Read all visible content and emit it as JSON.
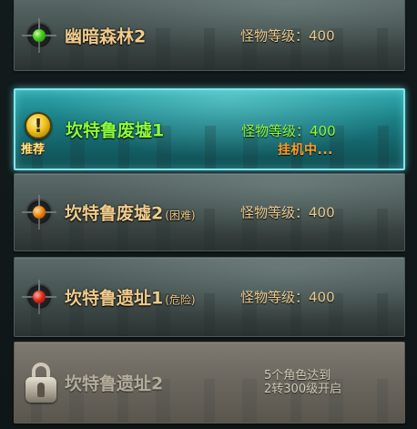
{
  "maps": [
    {
      "name": "幽暗森林2",
      "sub": "",
      "level_label": "怪物等级：",
      "level_value": "400",
      "indicator": "green-gem-icon",
      "state": "normal"
    },
    {
      "name": "坎特鲁废墟1",
      "sub": "",
      "level_label": "怪物等级：",
      "level_value": "400",
      "status": "挂机中...",
      "recommend_mark": "!",
      "recommend_label": "推荐",
      "state": "active"
    },
    {
      "name": "坎特鲁废墟2",
      "sub": "(困难)",
      "level_label": "怪物等级：",
      "level_value": "400",
      "indicator": "orange-gem-icon",
      "state": "normal"
    },
    {
      "name": "坎特鲁遗址1",
      "sub": "(危险)",
      "level_label": "怪物等级：",
      "level_value": "400",
      "indicator": "red-gem-icon",
      "state": "normal"
    },
    {
      "name": "坎特鲁遗址2",
      "sub": "",
      "unlock_line1": "5个角色达到",
      "unlock_line2": "2转300级开启",
      "indicator": "lock-icon",
      "state": "locked"
    }
  ],
  "colors": {
    "active_text": "#8cff3c",
    "normal_text": "#f0cb8c",
    "status_text": "#ff9c2a",
    "active_border": "#7fe6ec"
  }
}
